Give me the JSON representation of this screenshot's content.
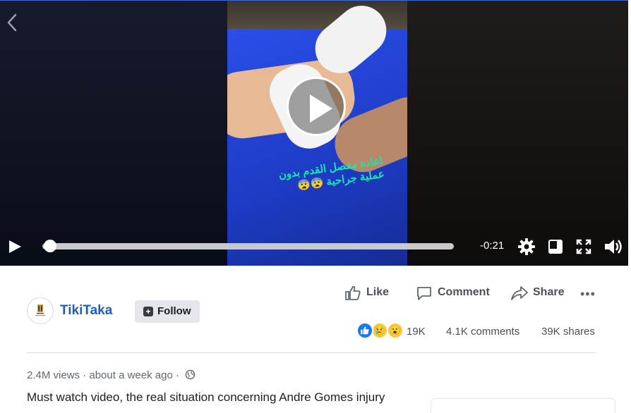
{
  "video": {
    "caption_text": "اعادة مفصل القدم بدون عملية جراحية 😨😨",
    "time_remaining": "-0:21",
    "progress": 0.0
  },
  "controls": {
    "icons": [
      "play-icon",
      "settings-icon",
      "mini-player-icon",
      "fullscreen-icon",
      "volume-icon"
    ]
  },
  "post": {
    "page_name": "TikiTaka",
    "avatar_text": "TIKITAKA",
    "follow_label": "Follow",
    "actions": {
      "like": "Like",
      "comment": "Comment",
      "share": "Share"
    },
    "reactions_count": "19K",
    "comments_count": "4.1K comments",
    "shares_count": "39K shares",
    "meta": {
      "views": "2.4M views",
      "separator": "·",
      "time": "about a week ago",
      "separator2": "·"
    },
    "description": "Must watch video, the real situation concerning Andre Gomes injury"
  },
  "colors": {
    "link_blue": "#1f5fb5",
    "like_blue": "#1877f2",
    "reaction_yellow": "#f7c93e"
  }
}
